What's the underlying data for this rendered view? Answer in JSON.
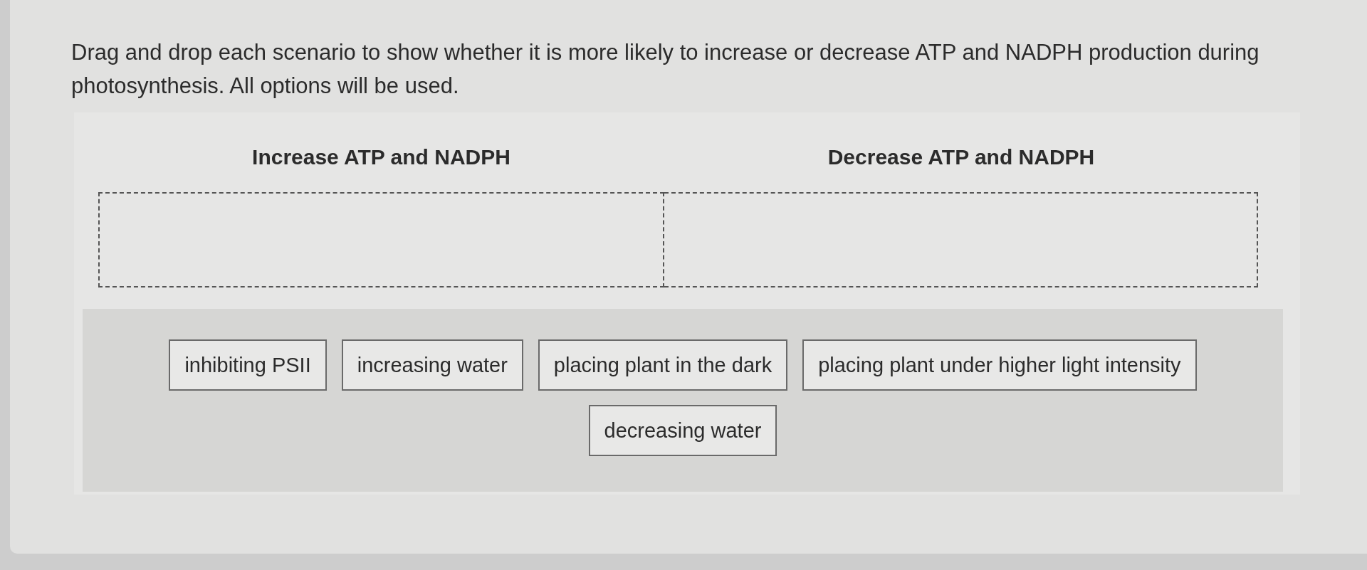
{
  "instruction": "Drag and drop each scenario to show whether it is more likely to increase or decrease ATP and NADPH production during photosynthesis. All options will be used.",
  "categories": [
    {
      "label": "Increase ATP and NADPH"
    },
    {
      "label": "Decrease ATP and NADPH"
    }
  ],
  "options": [
    {
      "label": "inhibiting PSII"
    },
    {
      "label": "increasing water"
    },
    {
      "label": "placing plant in the dark"
    },
    {
      "label": "placing plant under higher light intensity"
    },
    {
      "label": "decreasing water"
    }
  ]
}
